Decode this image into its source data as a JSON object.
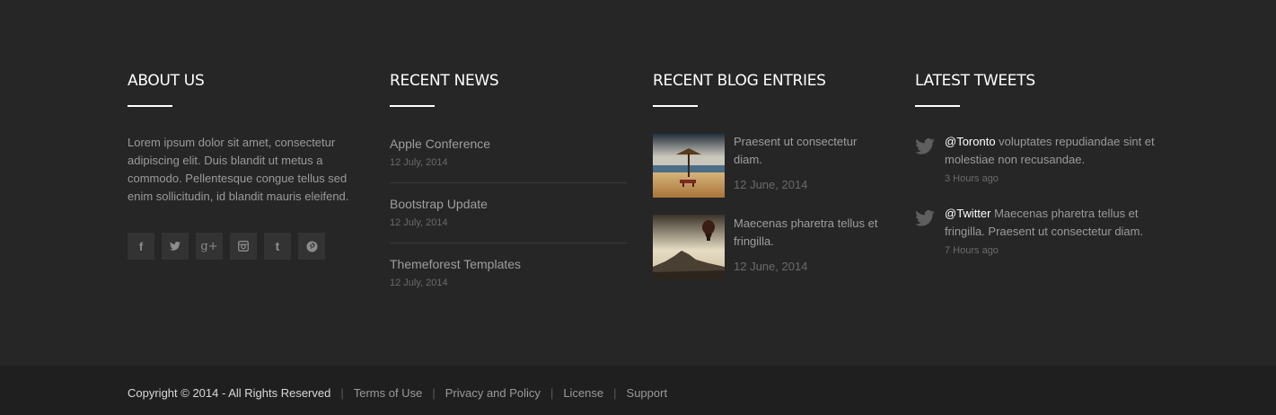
{
  "about": {
    "heading": "ABOUT US",
    "text": "Lorem ipsum dolor sit amet, consectetur adipiscing elit. Duis blandit ut metus a commodo. Pellentesque congue tellus sed enim sollicitudin, id blandit mauris eleifend.",
    "social": [
      {
        "icon": "facebook-icon",
        "glyph": "f"
      },
      {
        "icon": "twitter-icon",
        "glyph": ""
      },
      {
        "icon": "google-plus-icon",
        "glyph": "g+"
      },
      {
        "icon": "instagram-icon",
        "glyph": ""
      },
      {
        "icon": "tumblr-icon",
        "glyph": "t"
      },
      {
        "icon": "pinterest-icon",
        "glyph": ""
      }
    ]
  },
  "news": {
    "heading": "RECENT NEWS",
    "items": [
      {
        "title": "Apple Conference",
        "date": "12 July, 2014"
      },
      {
        "title": "Bootstrap Update",
        "date": "12 July, 2014"
      },
      {
        "title": "Themeforest Templates",
        "date": "12 July, 2014"
      }
    ]
  },
  "blog": {
    "heading": "RECENT BLOG ENTRIES",
    "items": [
      {
        "text": "Praesent ut consectetur diam.",
        "date": "12 June, 2014",
        "image": "beach-umbrella-image"
      },
      {
        "text": "Maecenas pharetra tellus et fringilla.",
        "date": "12 June, 2014",
        "image": "hot-air-balloon-image"
      }
    ]
  },
  "tweets": {
    "heading": "LATEST TWEETS",
    "items": [
      {
        "handle": "@Toronto",
        "text": " voluptates repudiandae sint et molestiae non recusandae.",
        "time": "3 Hours ago"
      },
      {
        "handle": "@Twitter",
        "text": " Maecenas pharetra tellus et fringilla. Praesent ut consectetur diam.",
        "time": "7 Hours ago"
      }
    ]
  },
  "bottom": {
    "copyright": "Copyright © 2014 - All Rights Reserved",
    "separator": "|",
    "links": [
      "Terms of Use",
      "Privacy and Policy",
      "License",
      "Support"
    ]
  },
  "colors": {
    "background": "#262626",
    "bottom_bar": "#1f1f1f",
    "heading": "#ffffff",
    "text": "#9a9a9a",
    "muted": "#6a6a6a",
    "social_bg": "#333333"
  }
}
